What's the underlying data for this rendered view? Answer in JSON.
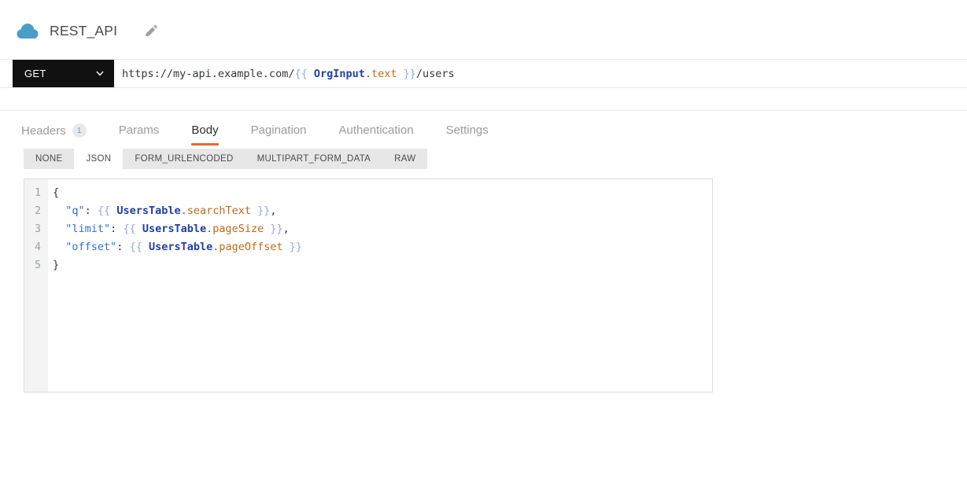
{
  "header": {
    "title": "REST_API"
  },
  "request_bar": {
    "method": "GET",
    "url_segments": [
      {
        "text": "https://my-api.example.com/",
        "style": "plain"
      },
      {
        "text": "{{ ",
        "style": "brace"
      },
      {
        "text": "OrgInput",
        "style": "entity"
      },
      {
        "text": ".",
        "style": "dot"
      },
      {
        "text": "text",
        "style": "prop"
      },
      {
        "text": " }}",
        "style": "brace"
      },
      {
        "text": "/users",
        "style": "plain"
      }
    ]
  },
  "tabs": {
    "items": [
      {
        "label": "Headers",
        "badge": "1",
        "active": false
      },
      {
        "label": "Params",
        "active": false
      },
      {
        "label": "Body",
        "active": true
      },
      {
        "label": "Pagination",
        "active": false
      },
      {
        "label": "Authentication",
        "active": false
      },
      {
        "label": "Settings",
        "active": false
      }
    ]
  },
  "body_type_tabs": {
    "items": [
      {
        "label": "NONE",
        "active": false
      },
      {
        "label": "JSON",
        "active": true
      },
      {
        "label": "FORM_URLENCODED",
        "active": false
      },
      {
        "label": "MULTIPART_FORM_DATA",
        "active": false
      },
      {
        "label": "RAW",
        "active": false
      }
    ]
  },
  "editor": {
    "lines": [
      {
        "number": "1",
        "tokens": [
          {
            "text": "{",
            "style": "plain"
          }
        ]
      },
      {
        "number": "2",
        "tokens": [
          {
            "text": "  ",
            "style": "plain"
          },
          {
            "text": "\"q\"",
            "style": "key"
          },
          {
            "text": ": ",
            "style": "plain"
          },
          {
            "text": "{{ ",
            "style": "brace"
          },
          {
            "text": "UsersTable",
            "style": "entity"
          },
          {
            "text": ".",
            "style": "dot"
          },
          {
            "text": "searchText",
            "style": "prop"
          },
          {
            "text": " }}",
            "style": "brace"
          },
          {
            "text": ",",
            "style": "plain"
          }
        ]
      },
      {
        "number": "3",
        "tokens": [
          {
            "text": "  ",
            "style": "plain"
          },
          {
            "text": "\"limit\"",
            "style": "key"
          },
          {
            "text": ": ",
            "style": "plain"
          },
          {
            "text": "{{ ",
            "style": "brace"
          },
          {
            "text": "UsersTable",
            "style": "entity"
          },
          {
            "text": ".",
            "style": "dot"
          },
          {
            "text": "pageSize",
            "style": "prop"
          },
          {
            "text": " }}",
            "style": "brace"
          },
          {
            "text": ",",
            "style": "plain"
          }
        ]
      },
      {
        "number": "4",
        "tokens": [
          {
            "text": "  ",
            "style": "plain"
          },
          {
            "text": "\"offset\"",
            "style": "key"
          },
          {
            "text": ": ",
            "style": "plain"
          },
          {
            "text": "{{ ",
            "style": "brace"
          },
          {
            "text": "UsersTable",
            "style": "entity"
          },
          {
            "text": ".",
            "style": "dot"
          },
          {
            "text": "pageOffset",
            "style": "prop"
          },
          {
            "text": " }}",
            "style": "brace"
          }
        ]
      },
      {
        "number": "5",
        "tokens": [
          {
            "text": "}",
            "style": "plain"
          }
        ]
      }
    ]
  },
  "colors": {
    "accent_orange": "#f0642e",
    "method_button_bg": "#111111",
    "cloud_blue": "#4b9cc9",
    "key_blue": "#3470cd",
    "entity_blue": "#21409a",
    "property_orange": "#bd6a1d",
    "mustache_blue": "#98aadd"
  }
}
